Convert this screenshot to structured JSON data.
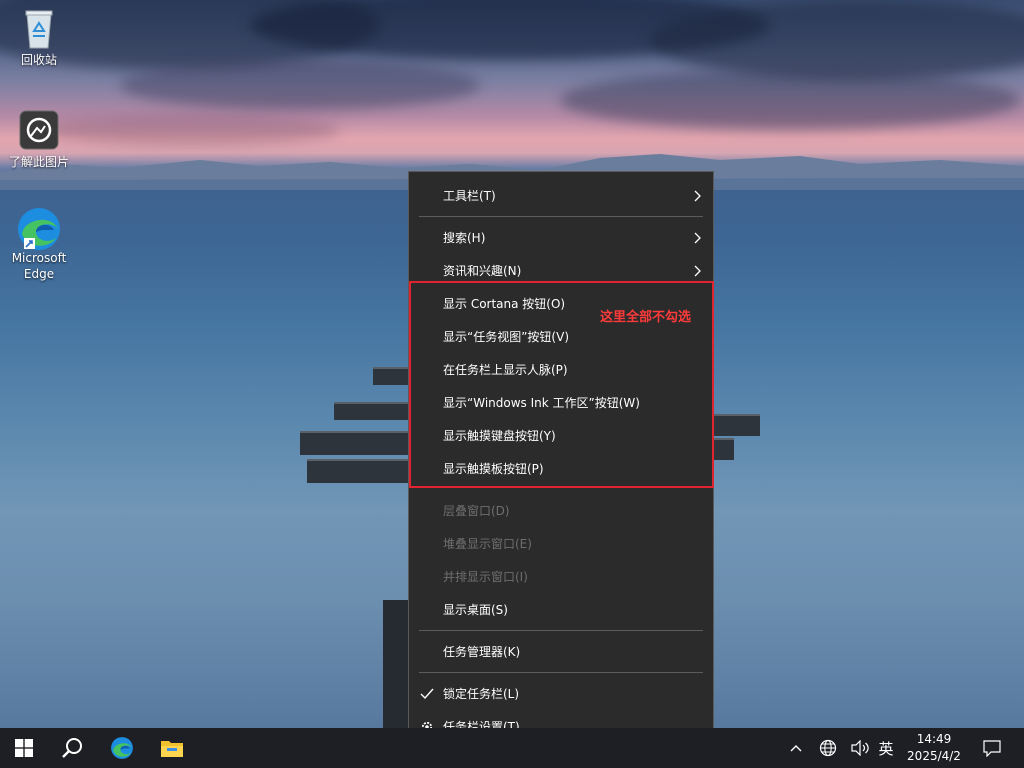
{
  "desktop_icons": [
    {
      "label": "回收站",
      "icon": "recycle-bin-icon"
    },
    {
      "label": "了解此图片",
      "icon": "camera-icon"
    },
    {
      "label": "Microsoft Edge",
      "icon": "edge-icon"
    }
  ],
  "context_menu": {
    "items": [
      {
        "label": "工具栏(T)",
        "has_submenu": true,
        "disabled": false
      },
      {
        "label": "搜索(H)",
        "has_submenu": true,
        "disabled": false
      },
      {
        "label": "资讯和兴趣(N)",
        "has_submenu": true,
        "disabled": false
      },
      {
        "label": "显示 Cortana 按钮(O)",
        "has_submenu": false,
        "disabled": false
      },
      {
        "label": "显示“任务视图”按钮(V)",
        "has_submenu": false,
        "disabled": false
      },
      {
        "label": "在任务栏上显示人脉(P)",
        "has_submenu": false,
        "disabled": false
      },
      {
        "label": "显示“Windows Ink 工作区”按钮(W)",
        "has_submenu": false,
        "disabled": false
      },
      {
        "label": "显示触摸键盘按钮(Y)",
        "has_submenu": false,
        "disabled": false
      },
      {
        "label": "显示触摸板按钮(P)",
        "has_submenu": false,
        "disabled": false
      },
      {
        "label": "层叠窗口(D)",
        "has_submenu": false,
        "disabled": true
      },
      {
        "label": "堆叠显示窗口(E)",
        "has_submenu": false,
        "disabled": true
      },
      {
        "label": "并排显示窗口(I)",
        "has_submenu": false,
        "disabled": true
      },
      {
        "label": "显示桌面(S)",
        "has_submenu": false,
        "disabled": false
      },
      {
        "label": "任务管理器(K)",
        "has_submenu": false,
        "disabled": false
      },
      {
        "label": "锁定任务栏(L)",
        "has_submenu": false,
        "disabled": false,
        "checked": true
      },
      {
        "label": "任务栏设置(T)",
        "has_submenu": false,
        "disabled": false,
        "icon": "gear-icon"
      }
    ]
  },
  "annotation": {
    "text": "这里全部不勾选",
    "color": "#e0242f"
  },
  "taskbar": {
    "apps": [
      "windows-start-icon",
      "search-icon",
      "edge-icon",
      "file-explorer-icon"
    ],
    "tray": {
      "ime_label": "英",
      "time": "14:49",
      "date": "2025/4/2"
    }
  }
}
